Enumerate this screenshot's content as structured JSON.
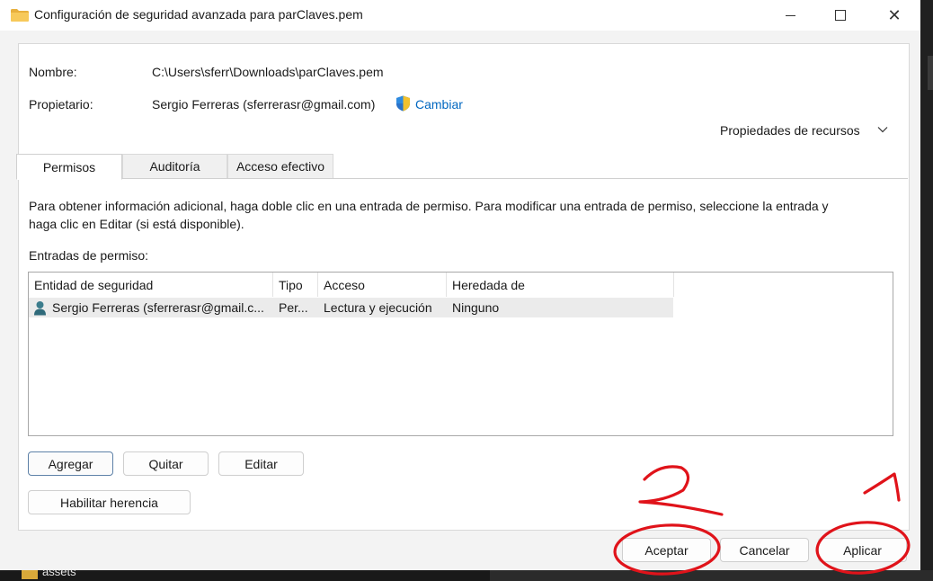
{
  "window": {
    "title": "Configuración de seguridad avanzada para parClaves.pem",
    "minimize_icon": "minimize-icon",
    "maximize_icon": "maximize-icon",
    "close_glyph": "✕"
  },
  "info": {
    "name_label": "Nombre:",
    "name_value": "C:\\Users\\sferr\\Downloads\\parClaves.pem",
    "owner_label": "Propietario:",
    "owner_value": "Sergio Ferreras (sferrerasr@gmail.com)",
    "change_link": "Cambiar",
    "resource_props": "Propiedades de recursos",
    "chevron": "chevron-down-icon"
  },
  "tabs": [
    {
      "label": "Permisos",
      "active": true
    },
    {
      "label": "Auditoría",
      "active": false
    },
    {
      "label": "Acceso efectivo",
      "active": false
    }
  ],
  "description": {
    "line1": "Para obtener información adicional, haga doble clic en una entrada de permiso. Para modificar una entrada de permiso, seleccione la entrada y",
    "line2": "haga clic en Editar (si está disponible)."
  },
  "entries": {
    "label": "Entradas de permiso:",
    "columns": [
      "Entidad de seguridad",
      "Tipo",
      "Acceso",
      "Heredada de"
    ],
    "rows": [
      {
        "entity": "Sergio Ferreras (sferrerasr@gmail.c...",
        "type": "Per...",
        "access": "Lectura y ejecución",
        "inherited": "Ninguno"
      }
    ]
  },
  "actions": {
    "add": "Agregar",
    "remove": "Quitar",
    "edit": "Editar",
    "enable_inheritance": "Habilitar herencia"
  },
  "footer": {
    "ok": "Aceptar",
    "cancel": "Cancelar",
    "apply": "Aplicar"
  },
  "background": {
    "folder_label": "assets"
  },
  "colors": {
    "accent_link": "#0067c0",
    "annotation_red": "#e0131a"
  }
}
